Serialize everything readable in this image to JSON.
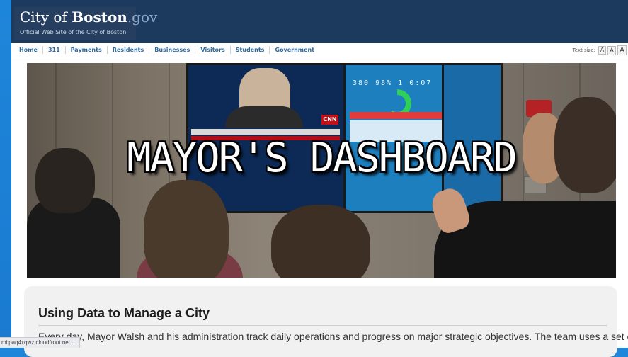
{
  "header": {
    "brand_prefix": "City of ",
    "brand_strong": "Boston",
    "brand_suffix": ".gov",
    "tagline": "Official Web Site of the City of Boston"
  },
  "nav": {
    "items": [
      "Home",
      "311",
      "Payments",
      "Residents",
      "Businesses",
      "Visitors",
      "Students",
      "Government"
    ],
    "text_size_label": "Text size:",
    "text_size_buttons": [
      "A",
      "A",
      "A"
    ]
  },
  "hero": {
    "title": "MAYOR'S DASHBOARD",
    "screen_numbers": "380  98%  1    0:07",
    "cnn_logo": "CNN"
  },
  "content": {
    "heading": "Using Data to Manage a City",
    "paragraph": "Every day, Mayor Walsh and his administration track daily operations and progress on major strategic objectives. The team uses a set of"
  },
  "status_bar": {
    "url": "miipaq4xqwz.cloudfront.net..."
  },
  "colors": {
    "header_bg": "#1c3a5e",
    "nav_link": "#2c6aa0",
    "page_bg": "#1f86d9"
  }
}
